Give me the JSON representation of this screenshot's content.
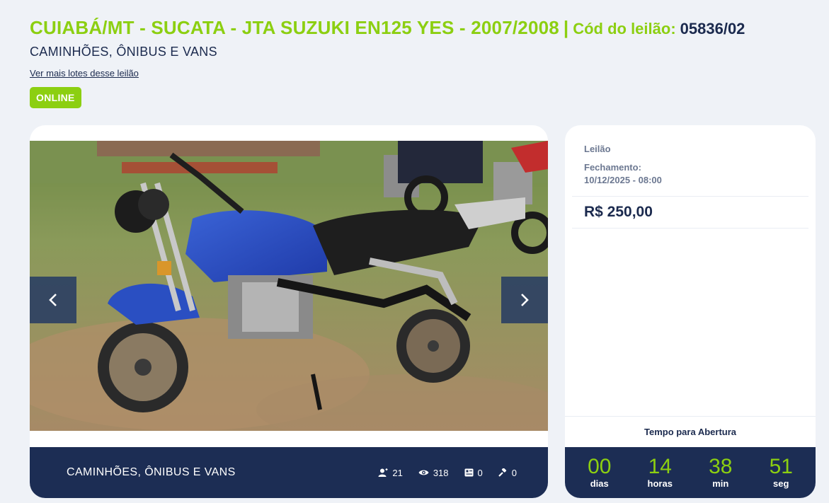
{
  "header": {
    "title": "CUIABÁ/MT - SUCATA - JTA SUZUKI EN125 YES - 2007/2008",
    "separator": "|",
    "code_label": "Cód do leilão:",
    "code_value": "05836/02",
    "category": "CAMINHÕES, ÔNIBUS E VANS",
    "more_lots_link": "Ver mais lotes desse leilão",
    "status_badge": "ONLINE"
  },
  "gallery": {
    "image_alt": "blue-motorcycle-photo",
    "footer_category": "CAMINHÕES, ÔNIBUS E VANS",
    "stats": [
      {
        "icon": "user-plus-icon",
        "value": "21"
      },
      {
        "icon": "eye-icon",
        "value": "318"
      },
      {
        "icon": "document-icon",
        "value": "0"
      },
      {
        "icon": "gavel-icon",
        "value": "0"
      }
    ]
  },
  "auction": {
    "kind": "Leilão",
    "closing_label": "Fechamento:",
    "closing_date": "10/12/2025 - 08:00",
    "price": "R$ 250,00",
    "opening_label": "Tempo para Abertura",
    "countdown": [
      {
        "value": "00",
        "unit": "dias"
      },
      {
        "value": "14",
        "unit": "horas"
      },
      {
        "value": "38",
        "unit": "min"
      },
      {
        "value": "51",
        "unit": "seg"
      }
    ]
  },
  "colors": {
    "accent_green": "#8ccf11",
    "navy": "#1c2d54",
    "page_bg": "#eff2f7"
  }
}
